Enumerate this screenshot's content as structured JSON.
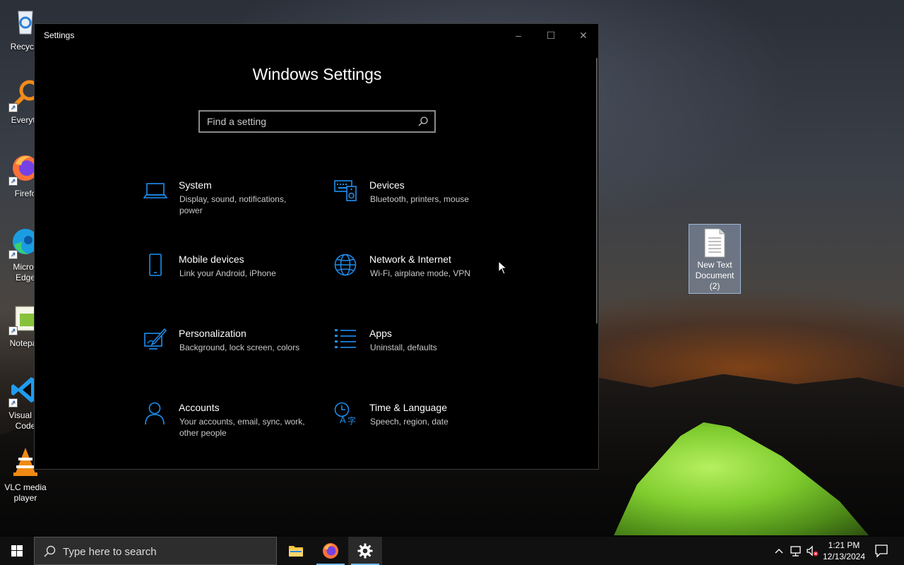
{
  "desktop": {
    "icons": [
      {
        "label": "Recycle",
        "icon": "recycle-bin-icon"
      },
      {
        "label": "Everyth",
        "icon": "everything-search-icon"
      },
      {
        "label": "Firefo",
        "icon": "firefox-icon"
      },
      {
        "label": "Micros\nEdge",
        "icon": "edge-icon"
      },
      {
        "label": "Notepac",
        "icon": "notepad-plus-plus-icon"
      },
      {
        "label": "Visual St\nCode",
        "icon": "vscode-icon"
      },
      {
        "label": "VLC media\nplayer",
        "icon": "vlc-icon"
      }
    ],
    "file": {
      "label": "New Text\nDocument\n(2)",
      "icon": "text-document-icon"
    }
  },
  "window": {
    "title": "Settings",
    "controls": {
      "minimize": "–",
      "maximize": "☐",
      "close": "✕"
    },
    "heading": "Windows Settings",
    "search": {
      "placeholder": "Find a setting",
      "icon": "search-icon"
    },
    "categories": [
      {
        "name": "System",
        "desc": "Display, sound, notifications, power",
        "icon": "laptop-icon"
      },
      {
        "name": "Devices",
        "desc": "Bluetooth, printers, mouse",
        "icon": "devices-icon"
      },
      {
        "name": "Mobile devices",
        "desc": "Link your Android, iPhone",
        "icon": "phone-icon"
      },
      {
        "name": "Network & Internet",
        "desc": "Wi-Fi, airplane mode, VPN",
        "icon": "globe-icon"
      },
      {
        "name": "Personalization",
        "desc": "Background, lock screen, colors",
        "icon": "personalization-icon"
      },
      {
        "name": "Apps",
        "desc": "Uninstall, defaults",
        "icon": "apps-list-icon"
      },
      {
        "name": "Accounts",
        "desc": "Your accounts, email, sync, work, other people",
        "icon": "person-icon"
      },
      {
        "name": "Time & Language",
        "desc": "Speech, region, date",
        "icon": "time-language-icon"
      }
    ]
  },
  "taskbar": {
    "search_placeholder": "Type here to search",
    "apps": [
      {
        "name": "File Explorer",
        "icon": "folder-icon"
      },
      {
        "name": "Firefox",
        "icon": "firefox-icon"
      },
      {
        "name": "Settings",
        "icon": "gear-icon"
      }
    ],
    "time": "1:21 PM",
    "date": "12/13/2024"
  },
  "colors": {
    "accent": "#1e8ff0",
    "window_bg": "#000000",
    "taskbar_bg": "#101010"
  }
}
